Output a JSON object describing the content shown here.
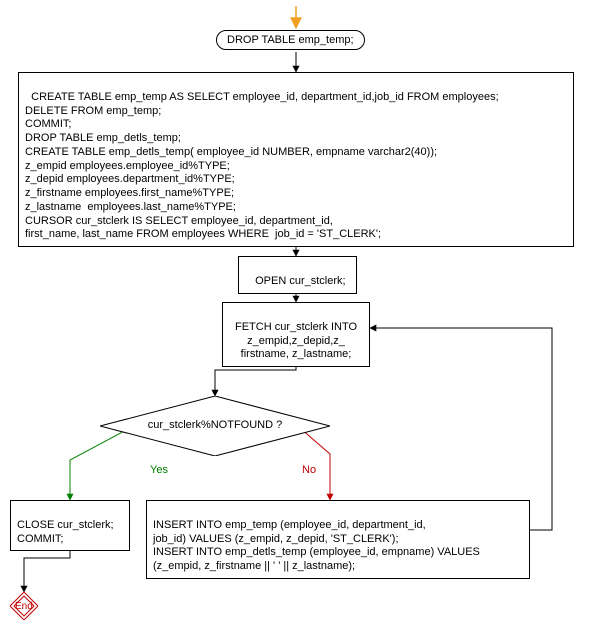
{
  "start_arrow_color": "#f0a020",
  "drop_table": "DROP TABLE emp_temp;",
  "create_block": "CREATE TABLE emp_temp AS SELECT employee_id, department_id,job_id FROM employees;\nDELETE FROM emp_temp;\nCOMMIT;\nDROP TABLE emp_detls_temp;\nCREATE TABLE emp_detls_temp( employee_id NUMBER, empname varchar2(40));\nz_empid employees.employee_id%TYPE;\nz_depid employees.department_id%TYPE;\nz_firstname employees.first_name%TYPE;\nz_lastname  employees.last_name%TYPE;\nCURSOR cur_stclerk IS SELECT employee_id, department_id,\nfirst_name, last_name FROM employees WHERE  job_id = 'ST_CLERK';",
  "open_cursor": "OPEN cur_stclerk;",
  "fetch_cursor": "FETCH cur_stclerk INTO\nz_empid,z_depid,z_\nfirstname, z_lastname;",
  "decision": "cur_stclerk%NOTFOUND ?",
  "yes_label": "Yes",
  "no_label": "No",
  "close_block": "CLOSE cur_stclerk;\nCOMMIT;",
  "insert_block": "INSERT INTO emp_temp (employee_id, department_id,\njob_id) VALUES  (z_empid, z_depid, 'ST_CLERK');\nINSERT INTO emp_detls_temp (employee_id, empname) VALUES\n(z_empid, z_firstname || ' ' || z_lastname);",
  "end_label": "End",
  "chart_data": {
    "type": "flowchart",
    "nodes": [
      {
        "id": "start",
        "type": "start",
        "label": ""
      },
      {
        "id": "drop",
        "type": "process-rounded",
        "label": "DROP TABLE emp_temp;"
      },
      {
        "id": "create",
        "type": "process",
        "label": "CREATE TABLE emp_temp AS SELECT employee_id, department_id,job_id FROM employees; DELETE FROM emp_temp; COMMIT; DROP TABLE emp_detls_temp; CREATE TABLE emp_detls_temp( employee_id NUMBER, empname varchar2(40)); z_empid employees.employee_id%TYPE; z_depid employees.department_id%TYPE; z_firstname employees.first_name%TYPE; z_lastname  employees.last_name%TYPE; CURSOR cur_stclerk IS SELECT employee_id, department_id, first_name, last_name FROM employees WHERE  job_id = 'ST_CLERK';"
      },
      {
        "id": "open",
        "type": "process",
        "label": "OPEN cur_stclerk;"
      },
      {
        "id": "fetch",
        "type": "process",
        "label": "FETCH cur_stclerk INTO z_empid,z_depid,z_firstname, z_lastname;"
      },
      {
        "id": "decision",
        "type": "decision",
        "label": "cur_stclerk%NOTFOUND ?"
      },
      {
        "id": "close",
        "type": "process",
        "label": "CLOSE cur_stclerk; COMMIT;"
      },
      {
        "id": "insert",
        "type": "process",
        "label": "INSERT INTO emp_temp (employee_id, department_id, job_id) VALUES  (z_empid, z_depid, 'ST_CLERK'); INSERT INTO emp_detls_temp (employee_id, empname) VALUES (z_empid, z_firstname || ' ' || z_lastname);"
      },
      {
        "id": "end",
        "type": "terminator",
        "label": "End"
      }
    ],
    "edges": [
      {
        "from": "start",
        "to": "drop"
      },
      {
        "from": "drop",
        "to": "create"
      },
      {
        "from": "create",
        "to": "open"
      },
      {
        "from": "open",
        "to": "fetch"
      },
      {
        "from": "fetch",
        "to": "decision"
      },
      {
        "from": "decision",
        "to": "close",
        "label": "Yes"
      },
      {
        "from": "decision",
        "to": "insert",
        "label": "No"
      },
      {
        "from": "insert",
        "to": "fetch"
      },
      {
        "from": "close",
        "to": "end"
      }
    ]
  }
}
